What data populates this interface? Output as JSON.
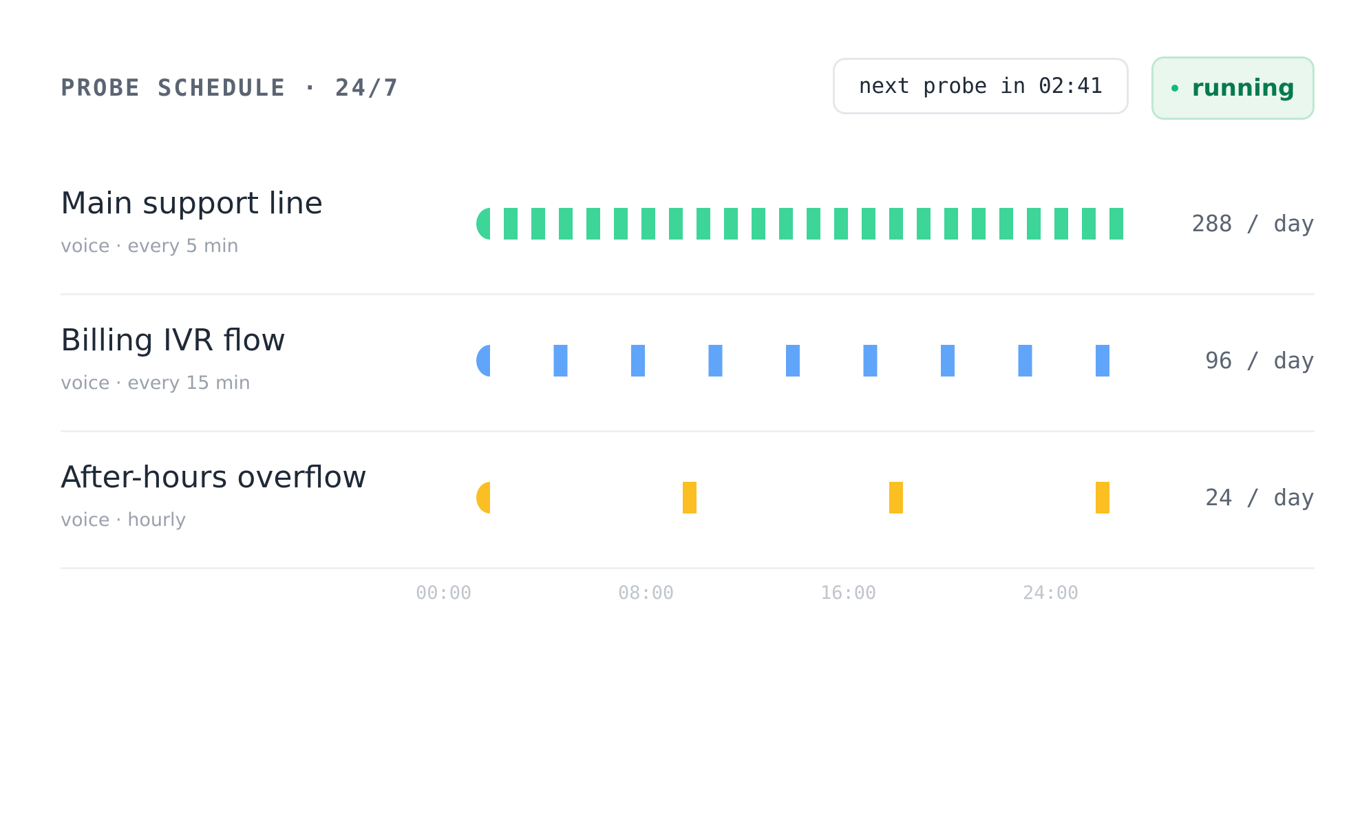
{
  "header": {
    "title": "PROBE SCHEDULE · 24/7",
    "next_probe": "next probe in 02:41",
    "status": "running",
    "status_color": "#10b981"
  },
  "rows": [
    {
      "name": "Main support line",
      "subtitle": "voice · every 5 min",
      "rate": "288 / day",
      "interval_minutes": 5,
      "color": "#3dd598"
    },
    {
      "name": "Billing IVR flow",
      "subtitle": "voice · every 15 min",
      "rate": "96 / day",
      "interval_minutes": 15,
      "color": "#60a5fa"
    },
    {
      "name": "After-hours overflow",
      "subtitle": "voice · hourly",
      "rate": "24 / day",
      "interval_minutes": 60,
      "color": "#fbbf24"
    }
  ],
  "axis": {
    "ticks": [
      "00:00",
      "08:00",
      "16:00",
      "24:00"
    ]
  }
}
